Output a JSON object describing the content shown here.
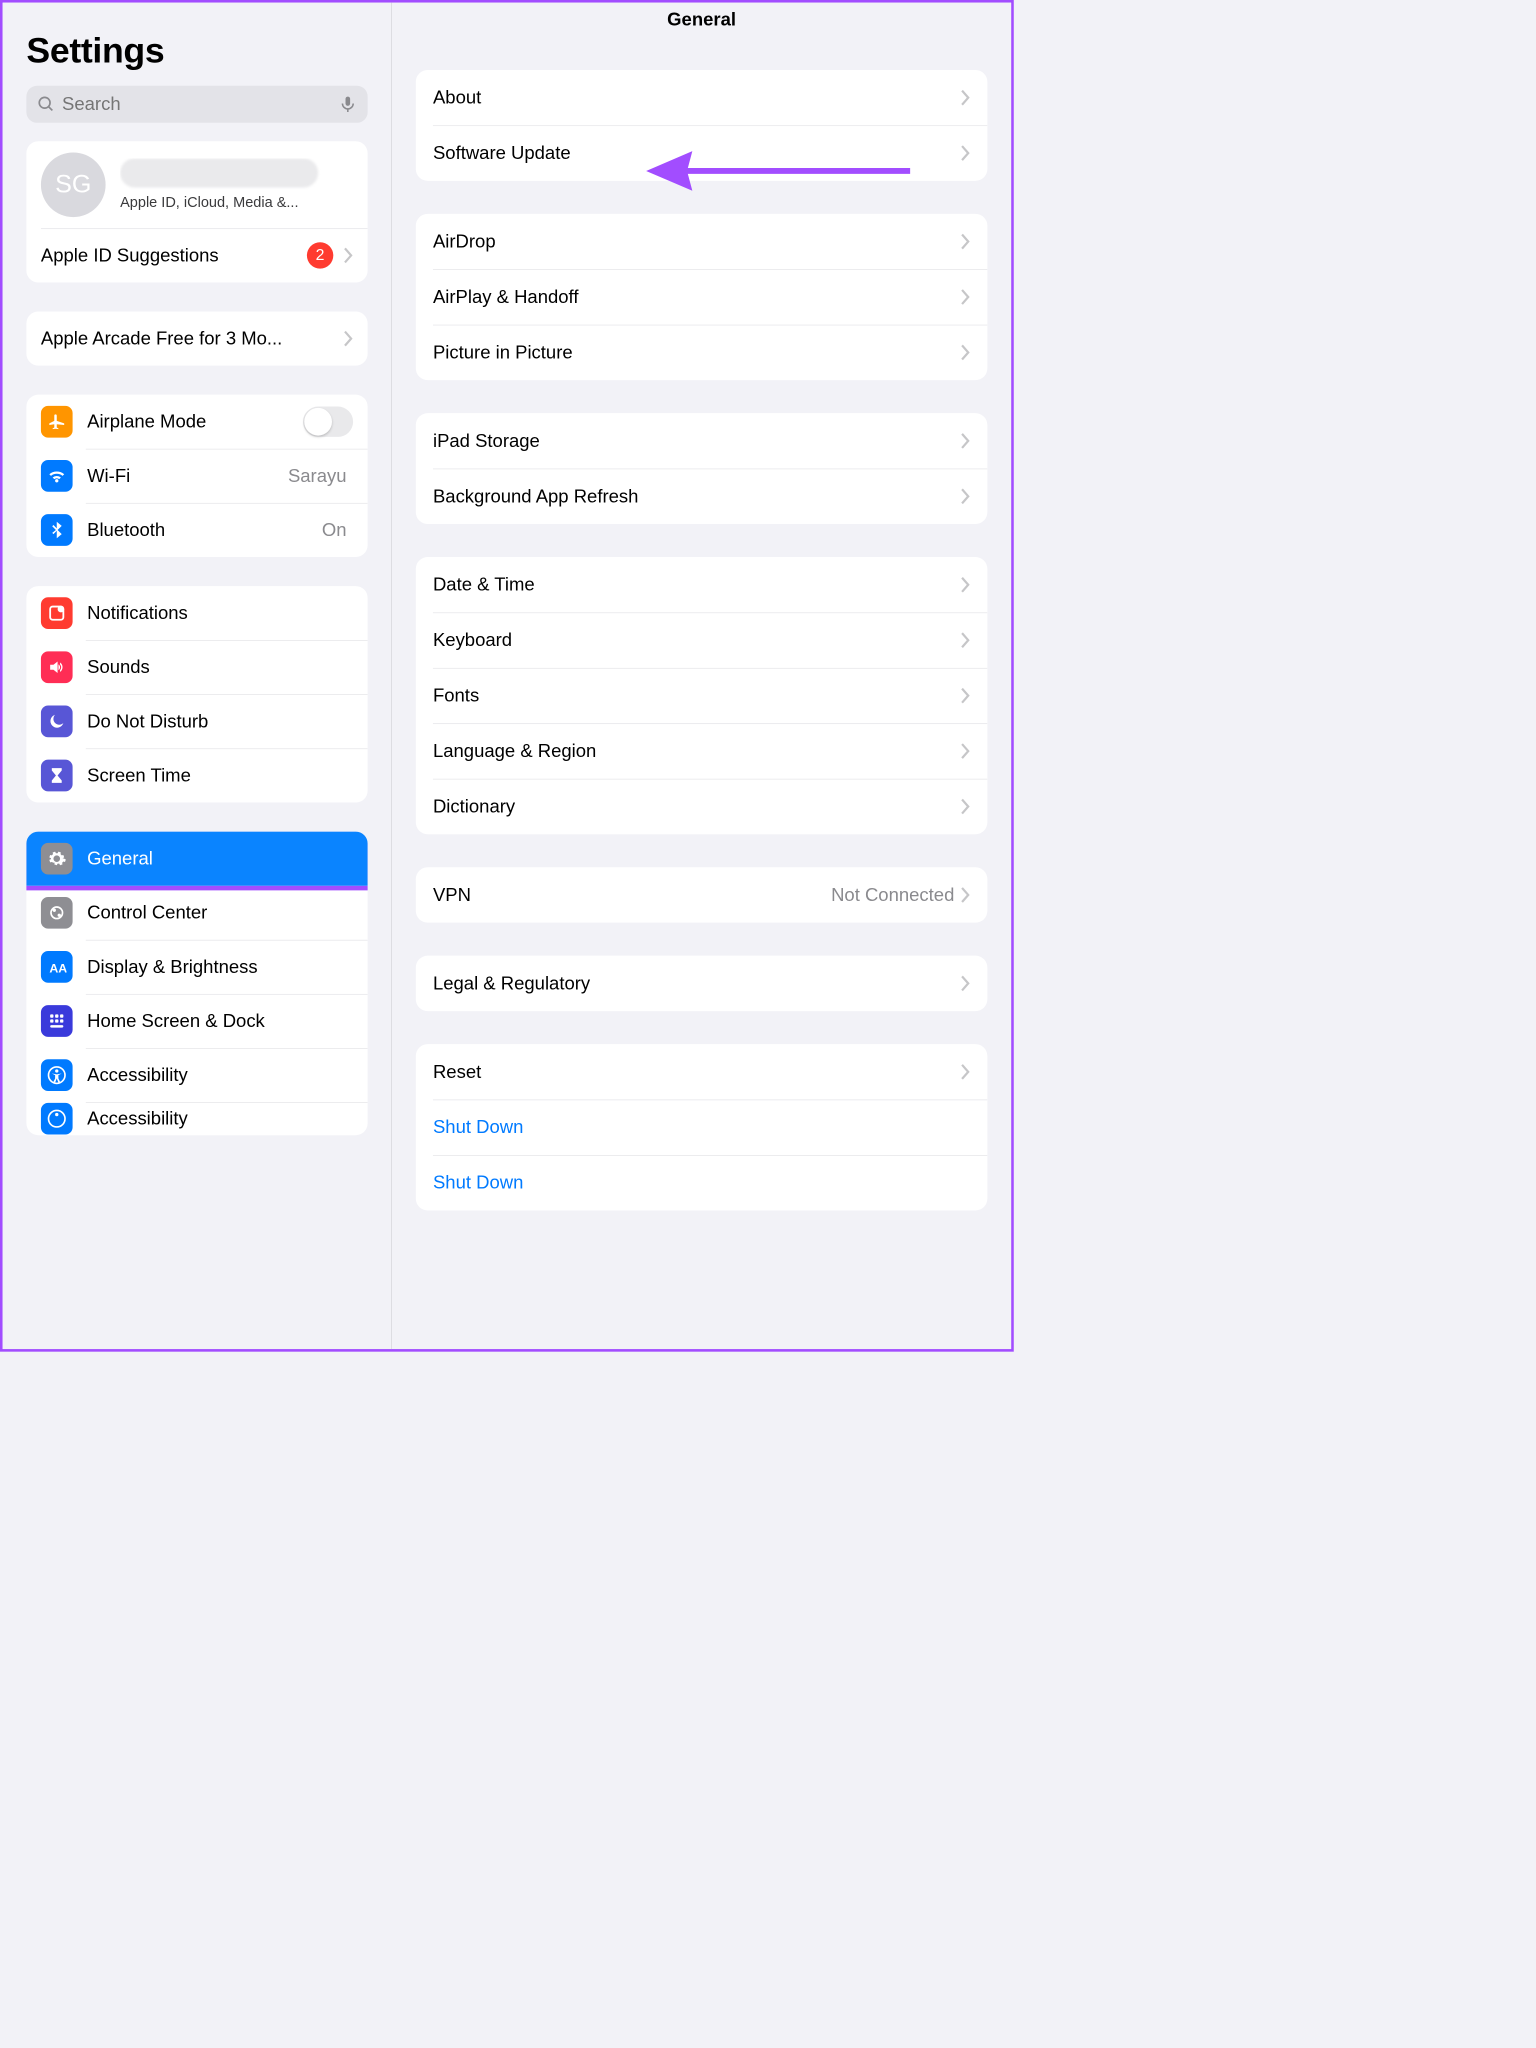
{
  "sidebar": {
    "title": "Settings",
    "search_placeholder": "Search",
    "profile": {
      "initials": "SG",
      "subtitle": "Apple ID, iCloud, Media &..."
    },
    "apple_id_suggestions": {
      "label": "Apple ID Suggestions",
      "badge": "2"
    },
    "promo": {
      "label": "Apple Arcade Free for 3 Mo..."
    },
    "group_connectivity": [
      {
        "key": "airplane",
        "label": "Airplane Mode",
        "toggle": false
      },
      {
        "key": "wifi",
        "label": "Wi-Fi",
        "value": "Sarayu"
      },
      {
        "key": "bluetooth",
        "label": "Bluetooth",
        "value": "On"
      }
    ],
    "group_notifications": [
      {
        "key": "notifications",
        "label": "Notifications"
      },
      {
        "key": "sounds",
        "label": "Sounds"
      },
      {
        "key": "dnd",
        "label": "Do Not Disturb"
      },
      {
        "key": "screentime",
        "label": "Screen Time"
      }
    ],
    "group_system": [
      {
        "key": "general",
        "label": "General",
        "selected": true
      },
      {
        "key": "controlcenter",
        "label": "Control Center"
      },
      {
        "key": "display",
        "label": "Display & Brightness"
      },
      {
        "key": "homescreen",
        "label": "Home Screen & Dock"
      },
      {
        "key": "accessibility",
        "label": "Accessibility"
      },
      {
        "key": "accessibility2",
        "label": "Accessibility"
      }
    ]
  },
  "main": {
    "title": "General",
    "groups": [
      [
        {
          "label": "About"
        },
        {
          "label": "Software Update"
        }
      ],
      [
        {
          "label": "AirDrop"
        },
        {
          "label": "AirPlay & Handoff"
        },
        {
          "label": "Picture in Picture"
        }
      ],
      [
        {
          "label": "iPad Storage"
        },
        {
          "label": "Background App Refresh"
        }
      ],
      [
        {
          "label": "Date & Time"
        },
        {
          "label": "Keyboard"
        },
        {
          "label": "Fonts"
        },
        {
          "label": "Language & Region"
        },
        {
          "label": "Dictionary"
        }
      ],
      [
        {
          "label": "VPN",
          "value": "Not Connected"
        }
      ],
      [
        {
          "label": "Legal & Regulatory"
        }
      ],
      [
        {
          "label": "Reset"
        },
        {
          "label": "Shut Down",
          "link": true,
          "no_chevron": true
        },
        {
          "label": "Shut Down",
          "link": true,
          "no_chevron": true
        }
      ]
    ]
  }
}
